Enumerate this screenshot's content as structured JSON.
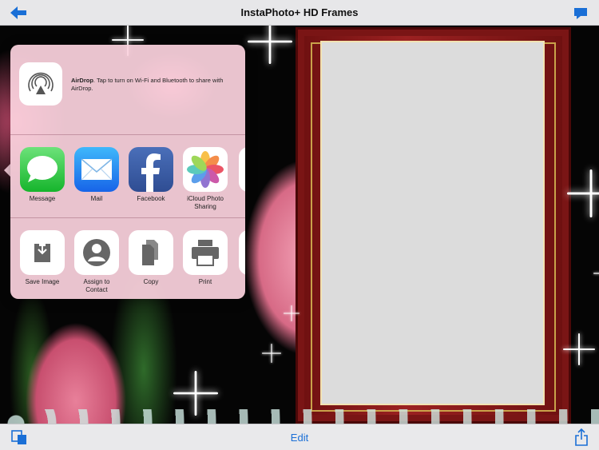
{
  "app": {
    "title": "InstaPhoto+ HD Frames"
  },
  "toolbar": {
    "edit_label": "Edit"
  },
  "airdrop": {
    "title": "AirDrop",
    "description": ". Tap to turn on Wi-Fi and Bluetooth to share with AirDrop."
  },
  "share_apps": [
    {
      "label": "Message",
      "icon": "message-icon",
      "color": "#2bc43b"
    },
    {
      "label": "Mail",
      "icon": "mail-icon",
      "color": "#2a8ef2"
    },
    {
      "label": "Facebook",
      "icon": "facebook-icon",
      "color": "#3b5998"
    },
    {
      "label": "iCloud Photo Sharing",
      "icon": "photos-icon",
      "color": "#ffffff"
    }
  ],
  "share_actions": [
    {
      "label": "Save Image",
      "icon": "save-image-icon"
    },
    {
      "label": "Assign to Contact",
      "icon": "contact-icon"
    },
    {
      "label": "Copy",
      "icon": "copy-icon"
    },
    {
      "label": "Print",
      "icon": "print-icon"
    }
  ],
  "colors": {
    "accent": "#1a6fd6",
    "sheet_background": "#fbd2de"
  }
}
